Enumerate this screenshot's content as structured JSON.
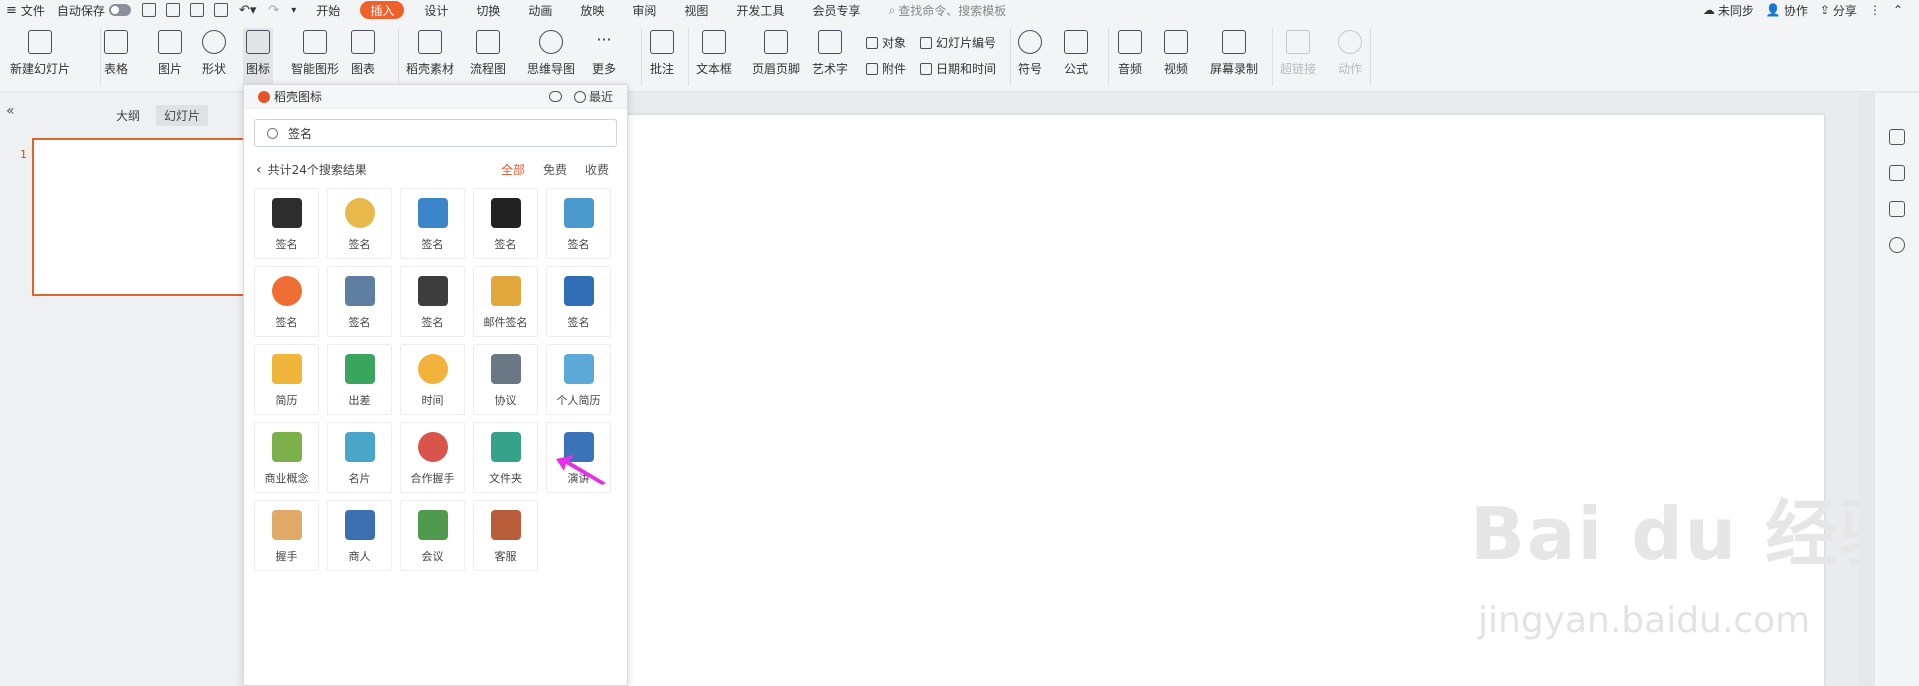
{
  "menubar": {
    "file": "文件",
    "autosave": "自动保存",
    "tabs": [
      "开始",
      "插入",
      "设计",
      "切换",
      "动画",
      "放映",
      "审阅",
      "视图",
      "开发工具",
      "会员专享"
    ],
    "active_tab": "插入",
    "search_placeholder": "查找命令、搜索模板",
    "sync": "未同步",
    "collab": "协作",
    "share": "分享"
  },
  "ribbon": {
    "new_slide": "新建幻灯片",
    "table": "表格",
    "picture": "图片",
    "shape": "形状",
    "icon": "图标",
    "smart_art": "智能图形",
    "chart": "图表",
    "material": "稻壳素材",
    "flowchart": "流程图",
    "mindmap": "思维导图",
    "more": "更多",
    "comment": "批注",
    "textbox": "文本框",
    "header_footer": "页眉页脚",
    "wordart": "艺术字",
    "object": "对象",
    "attachment": "附件",
    "slide_number": "幻灯片编号",
    "datetime": "日期和时间",
    "symbol": "符号",
    "formula": "公式",
    "audio": "音频",
    "video": "视频",
    "screen_record": "屏幕录制",
    "hyperlink": "超链接",
    "action": "动作",
    "more_glyph": "···"
  },
  "left_panel": {
    "outline_tab": "大纲",
    "slides_tab": "幻灯片",
    "slide_number": "1",
    "collapse_glyph": "«"
  },
  "icon_popup": {
    "title": "稻壳图标",
    "recent": "最近",
    "search_value": "签名",
    "result_text": "共计24个搜索结果",
    "filters": [
      "全部",
      "免费",
      "收费"
    ],
    "active_filter": "全部",
    "back_glyph": "‹",
    "icons": [
      {
        "label": "签名",
        "color": "#2d2d2d"
      },
      {
        "label": "签名",
        "color": "#e8b84a"
      },
      {
        "label": "签名",
        "color": "#3a86c8"
      },
      {
        "label": "签名",
        "color": "#222222"
      },
      {
        "label": "签名",
        "color": "#4a9ad0"
      },
      {
        "label": "签名",
        "color": "#ee6e34"
      },
      {
        "label": "签名",
        "color": "#5f7fa0"
      },
      {
        "label": "签名",
        "color": "#3d3d3d"
      },
      {
        "label": "邮件签名",
        "color": "#e2a83c"
      },
      {
        "label": "签名",
        "color": "#2f6eb5"
      },
      {
        "label": "简历",
        "color": "#f0b63c"
      },
      {
        "label": "出差",
        "color": "#3aa55c"
      },
      {
        "label": "时间",
        "color": "#f3b23c"
      },
      {
        "label": "协议",
        "color": "#6a7886"
      },
      {
        "label": "个人简历",
        "color": "#5aa9d6"
      },
      {
        "label": "商业概念",
        "color": "#7bb04a"
      },
      {
        "label": "名片",
        "color": "#4aa6c9"
      },
      {
        "label": "合作握手",
        "color": "#d9544a"
      },
      {
        "label": "文件夹",
        "color": "#37a28a"
      },
      {
        "label": "演讲",
        "color": "#3b73b9"
      },
      {
        "label": "握手",
        "color": "#e0a968"
      },
      {
        "label": "商人",
        "color": "#3a6fb0"
      },
      {
        "label": "会议",
        "color": "#4f9a4f"
      },
      {
        "label": "客服",
        "color": "#b95c3a"
      }
    ]
  },
  "watermark": {
    "main": "Bai du 经验",
    "sub": "jingyan.baidu.com"
  },
  "colors": {
    "accent": "#f0602b",
    "slide_border": "#e0642c",
    "arrow": "#e632e6"
  }
}
